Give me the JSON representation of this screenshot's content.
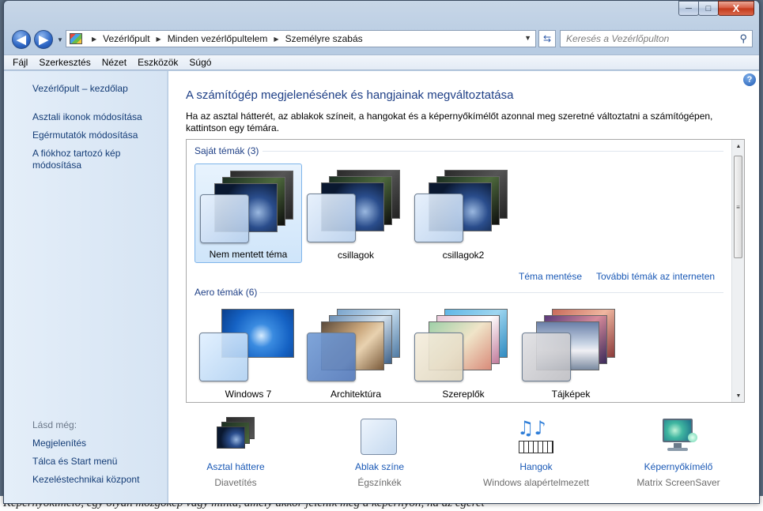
{
  "background_text": "Képernyőkímélő, egy olyan mozgókép vagy minta, amely akkor jelenik meg a képernyőn, ha az egeret",
  "window": {
    "controls": {
      "minimize": "─",
      "maximize": "□",
      "close": "X"
    }
  },
  "navigation": {
    "back_icon": "back-arrow-icon",
    "forward_icon": "forward-arrow-icon",
    "breadcrumbs": [
      "Vezérlőpult",
      "Minden vezérlőpultelem",
      "Személyre szabás"
    ],
    "search_placeholder": "Keresés a Vezérlőpulton"
  },
  "menubar": {
    "items": [
      "Fájl",
      "Szerkesztés",
      "Nézet",
      "Eszközök",
      "Súgó"
    ]
  },
  "sidebar": {
    "home": "Vezérlőpult – kezdőlap",
    "links": [
      "Asztali ikonok módosítása",
      "Egérmutatók módosítása",
      "A fiókhoz tartozó kép módosítása"
    ],
    "see_also_label": "Lásd még:",
    "see_also": [
      "Megjelenítés",
      "Tálca és Start menü",
      "Kezeléstechnikai központ"
    ]
  },
  "main": {
    "title": "A számítógép megjelenésének és hangjainak megváltoztatása",
    "description": "Ha az asztal hátterét, az ablakok színeit, a hangokat és a képernyőkímélőt azonnal meg szeretné változtatni a számítógépen, kattintson egy témára.",
    "my_themes_header": "Saját témák (3)",
    "my_themes": [
      "Nem mentett téma",
      "csillagok",
      "csillagok2"
    ],
    "save_theme_link": "Téma mentése",
    "more_themes_link": "További témák az interneten",
    "aero_header": "Aero témák (6)",
    "aero_themes": [
      "Windows 7",
      "Architektúra",
      "Szereplők",
      "Tájképek"
    ]
  },
  "bottom": [
    {
      "link": "Asztal háttere",
      "sub": "Diavetítés",
      "icon": "desktop-background-icon"
    },
    {
      "link": "Ablak színe",
      "sub": "Égszínkék",
      "icon": "window-color-icon"
    },
    {
      "link": "Hangok",
      "sub": "Windows alapértelmezett",
      "icon": "sounds-icon"
    },
    {
      "link": "Képernyőkímélő",
      "sub": "Matrix ScreenSaver",
      "icon": "screensaver-icon"
    }
  ],
  "colors": {
    "link": "#1a59b6",
    "heading": "#1e3f86",
    "selection": "#cfe5fa"
  }
}
